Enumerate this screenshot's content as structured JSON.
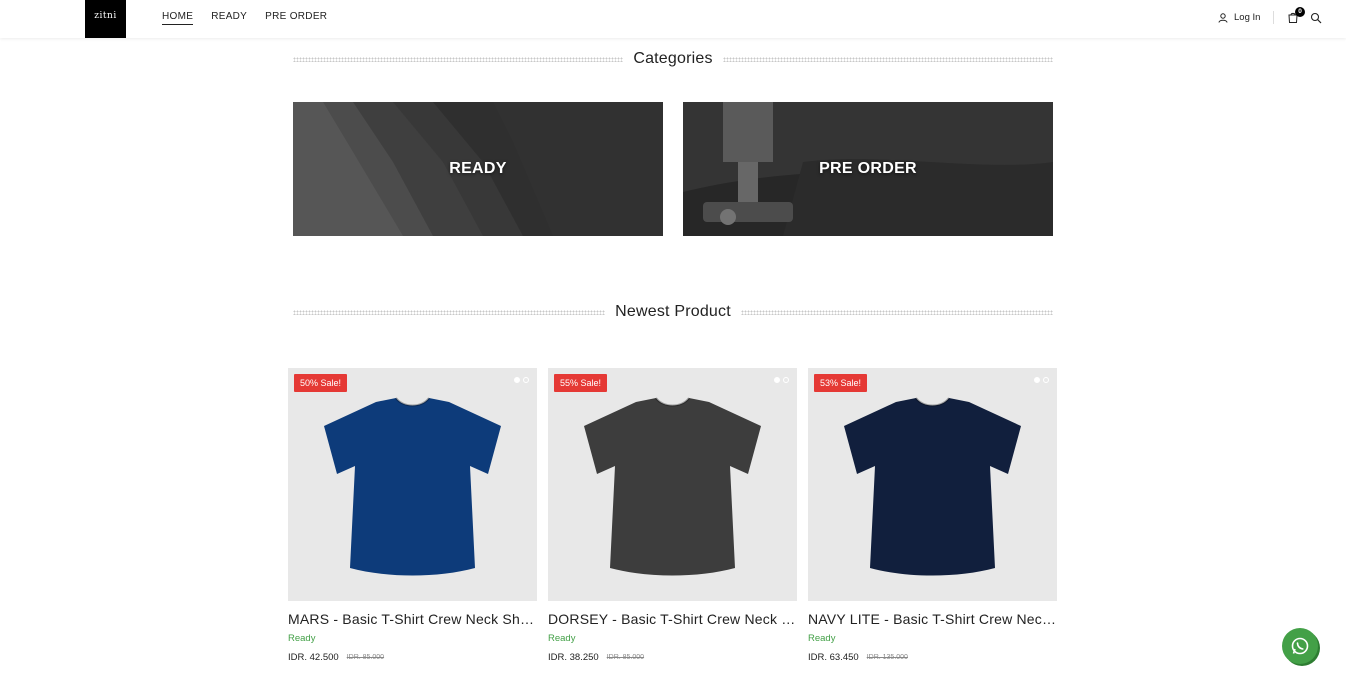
{
  "header": {
    "logo_text": "zitni",
    "nav": [
      {
        "label": "HOME",
        "active": true
      },
      {
        "label": "READY",
        "active": false
      },
      {
        "label": "PRE ORDER",
        "active": false
      }
    ],
    "login_label": "Log In",
    "cart_count": "0"
  },
  "categories": {
    "title": "Categories",
    "items": [
      {
        "label": "READY"
      },
      {
        "label": "PRE ORDER"
      }
    ]
  },
  "newest": {
    "title": "Newest Product",
    "products": [
      {
        "badge": "50% Sale!",
        "name": "MARS - Basic T-Shirt Crew Neck Short Sleeve",
        "status": "Ready",
        "price": "IDR. 42.500",
        "old_price": "IDR. 85.000",
        "shirt_color": "#0d3b7a"
      },
      {
        "badge": "55% Sale!",
        "name": "DORSEY - Basic T-Shirt Crew Neck Short Sleeve",
        "status": "Ready",
        "price": "IDR. 38.250",
        "old_price": "IDR. 85.000",
        "shirt_color": "#3d3d3d"
      },
      {
        "badge": "53% Sale!",
        "name": "NAVY LITE - Basic T-Shirt Crew Neck Short Sleeve",
        "status": "Ready",
        "price": "IDR. 63.450",
        "old_price": "IDR. 135.000",
        "shirt_color": "#111f3d"
      }
    ]
  },
  "colors": {
    "sale": "#e53935",
    "ready": "#43a047",
    "whatsapp": "#43a047"
  }
}
